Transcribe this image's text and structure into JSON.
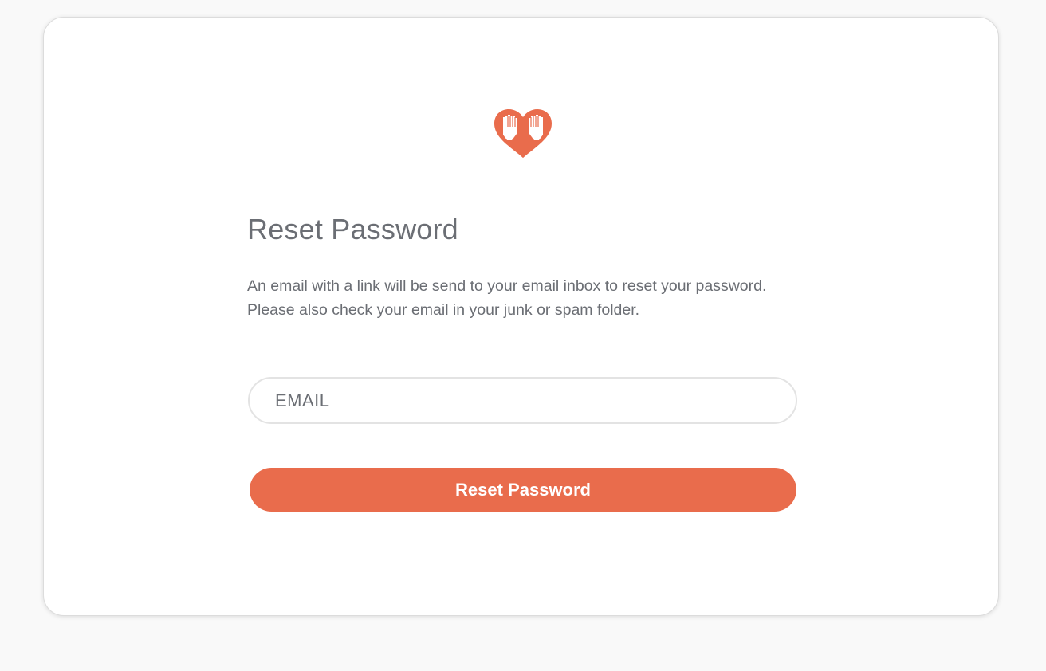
{
  "brand": {
    "logo_icon": "heart-hands-logo-icon",
    "accent_color": "#e96c4c"
  },
  "reset": {
    "title": "Reset Password",
    "description_line1": "An email with a link will be send to your email inbox to reset your password.",
    "description_line2": "Please also check your email in your junk or spam folder.",
    "email_placeholder": "EMAIL",
    "email_value": "",
    "submit_label": "Reset Password"
  }
}
